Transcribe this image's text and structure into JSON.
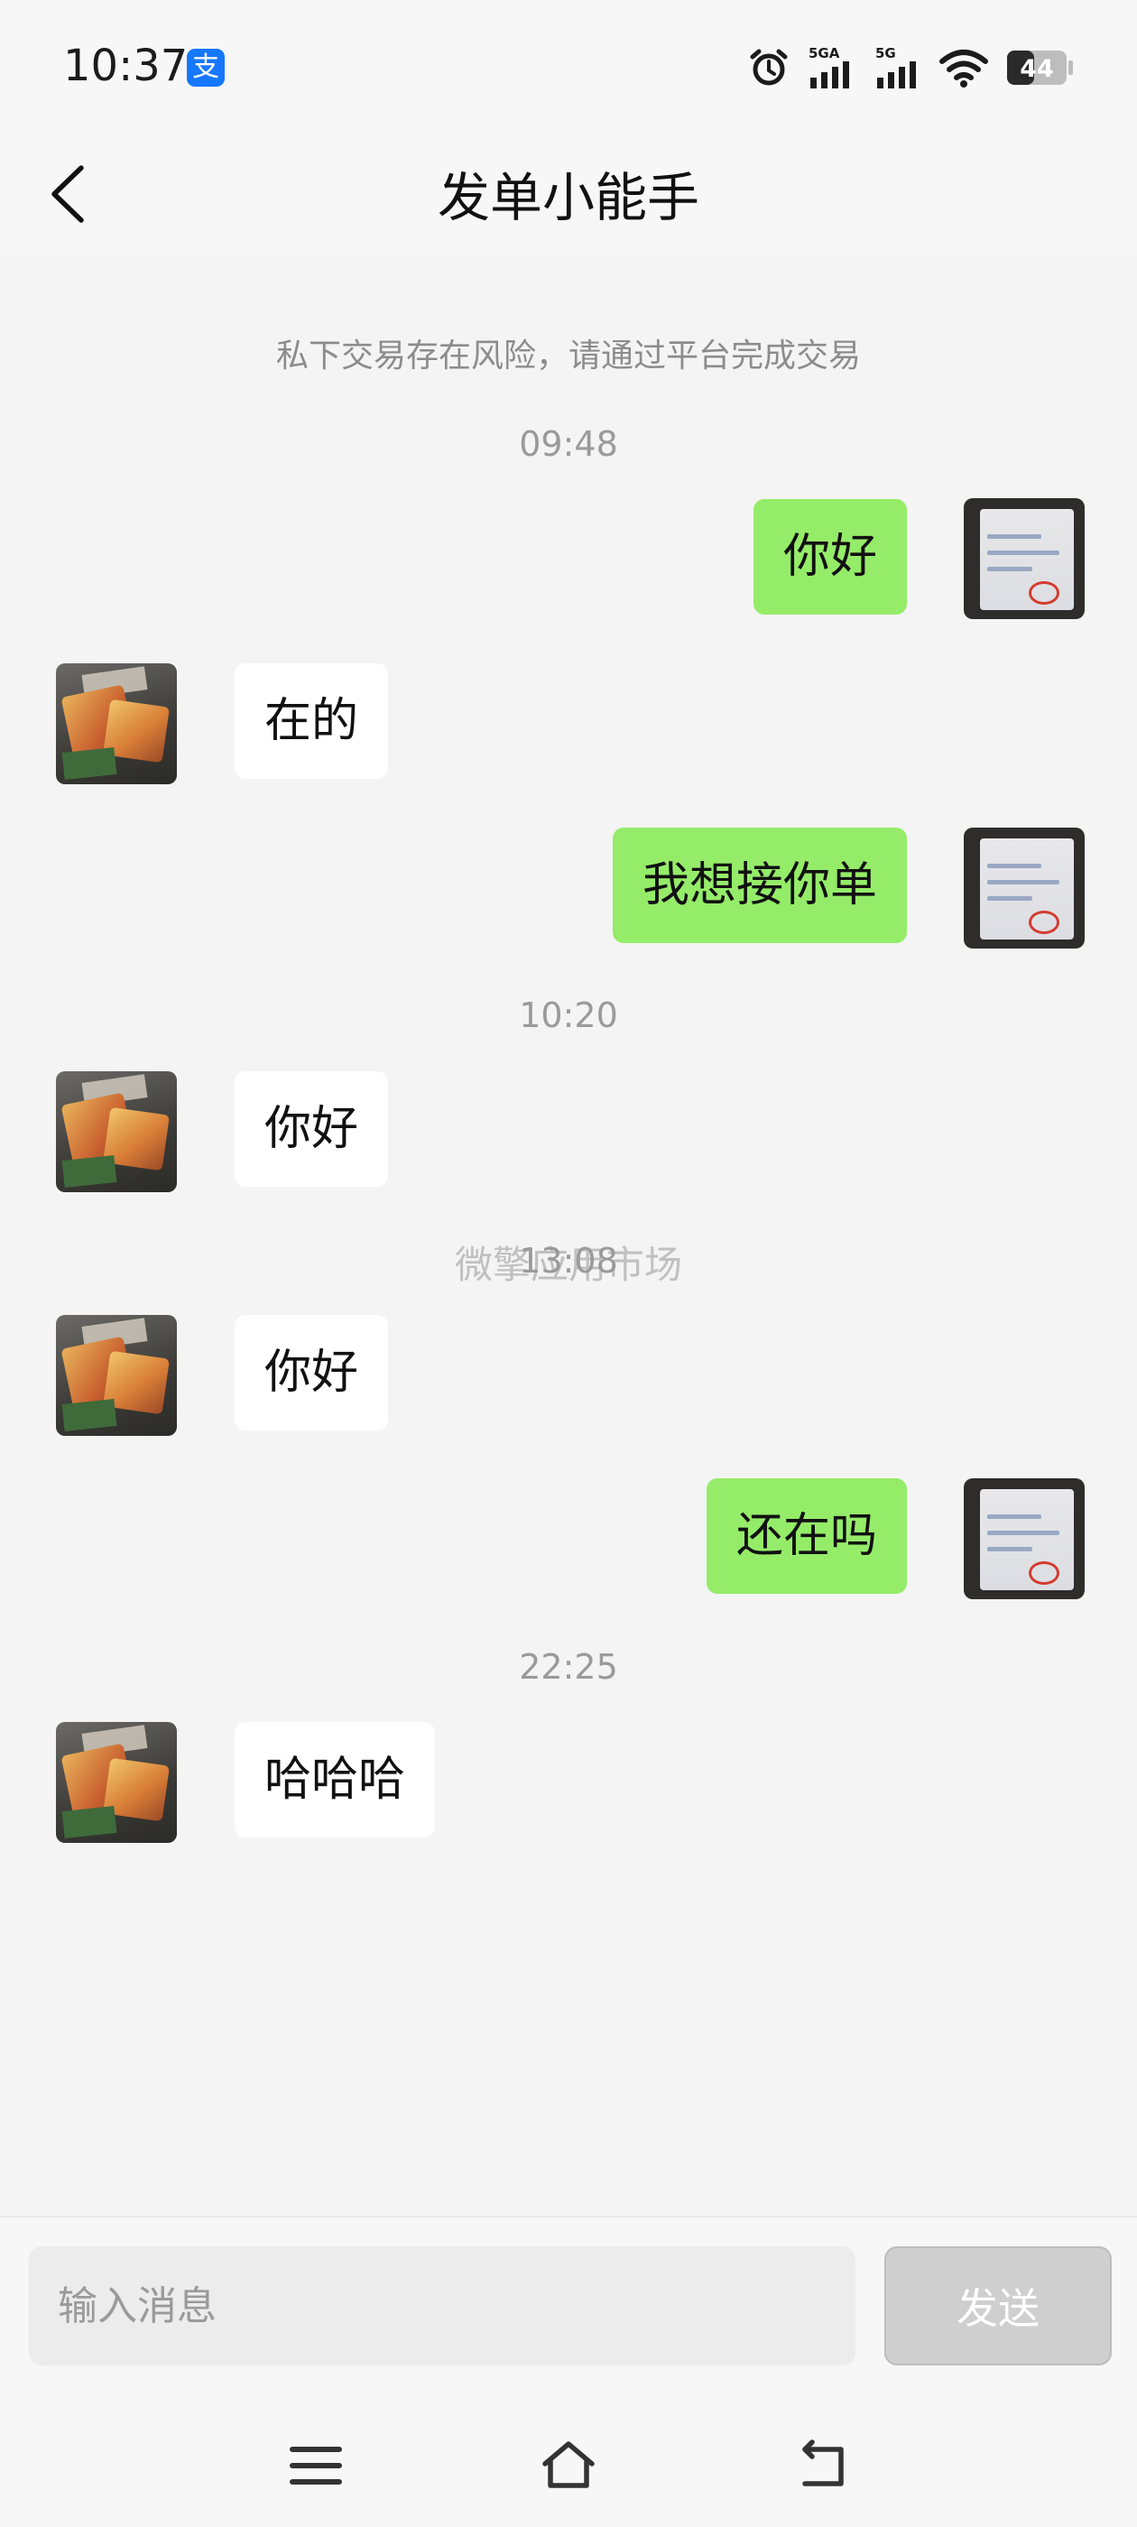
{
  "status_bar": {
    "time": "10:37",
    "app_badge": "支",
    "battery": "44",
    "network_1": "5GA",
    "network_2": "5G"
  },
  "header": {
    "title": "发单小能手"
  },
  "chat": {
    "notice": "私下交易存在风险，请通过平台完成交易",
    "watermark": "微擎应用市场",
    "items": [
      {
        "type": "time",
        "text": "09:48"
      },
      {
        "type": "message",
        "direction": "out",
        "text": "你好"
      },
      {
        "type": "message",
        "direction": "in",
        "text": "在的"
      },
      {
        "type": "message",
        "direction": "out",
        "text": "我想接你单"
      },
      {
        "type": "time",
        "text": "10:20"
      },
      {
        "type": "message",
        "direction": "in",
        "text": "你好"
      },
      {
        "type": "time",
        "text": "13:08"
      },
      {
        "type": "message",
        "direction": "in",
        "text": "你好"
      },
      {
        "type": "message",
        "direction": "out",
        "text": "还在吗"
      },
      {
        "type": "time",
        "text": "22:25"
      },
      {
        "type": "message",
        "direction": "in",
        "text": "哈哈哈"
      }
    ]
  },
  "composer": {
    "placeholder": "输入消息",
    "send_label": "发送"
  },
  "colors": {
    "outgoing_bubble": "#95ec69",
    "incoming_bubble": "#ffffff",
    "background": "#f4f4f4",
    "send_button_disabled": "#cfcfcf"
  },
  "icons": {
    "back": "chevron-left-icon",
    "menu": "menu-icon",
    "home": "home-icon",
    "return": "return-icon",
    "alarm": "alarm-icon",
    "wifi": "wifi-icon",
    "battery": "battery-icon"
  }
}
